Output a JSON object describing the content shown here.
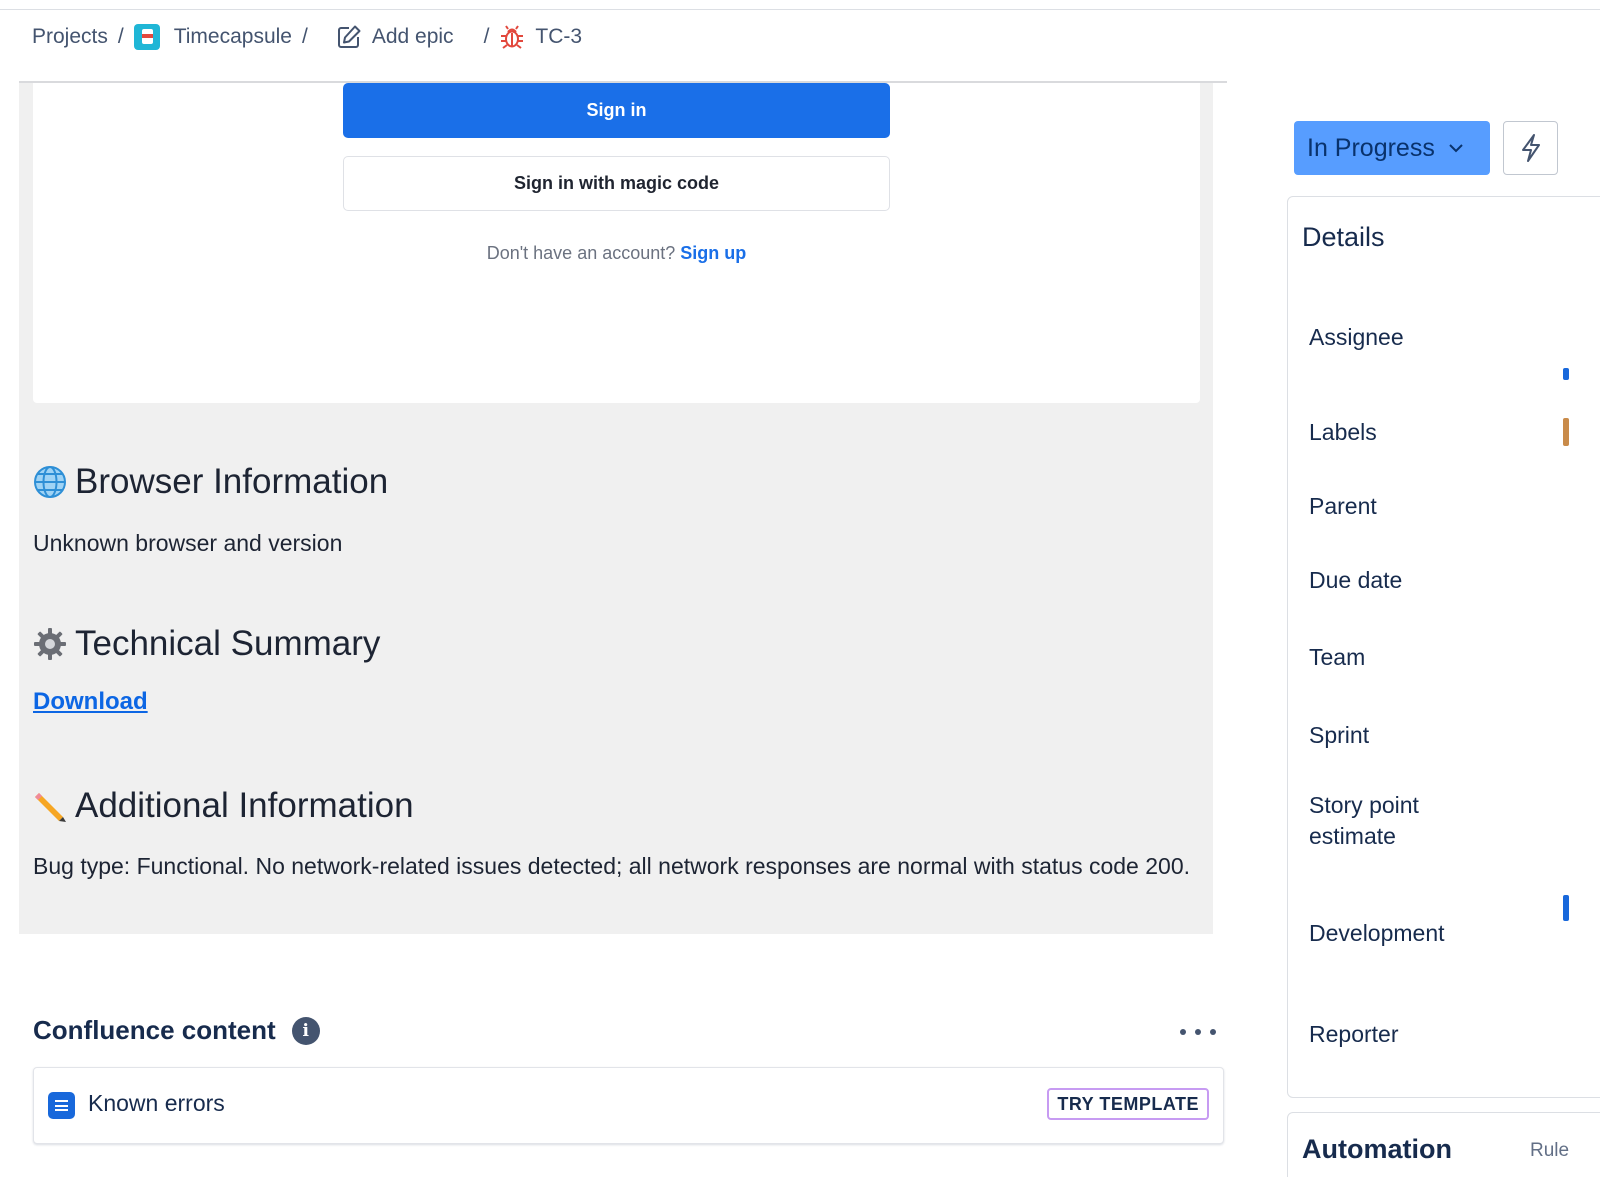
{
  "breadcrumb": {
    "projects": "Projects",
    "project": "Timecapsule",
    "epic": "Add epic",
    "issue": "TC-3",
    "separator": "/"
  },
  "screenshot": {
    "signin_label": "Sign in",
    "magic_label": "Sign in with magic code",
    "no_account_text": "Don't have an account?",
    "signup_link": "Sign up"
  },
  "description": {
    "browser_heading": "Browser Information",
    "browser_text": "Unknown browser and version",
    "technical_heading": "Technical Summary",
    "download_link": "Download",
    "additional_heading": "Additional Information",
    "additional_text": "Bug type: Functional. No network-related issues detected; all network responses are normal with status code 200."
  },
  "confluence": {
    "title": "Confluence content",
    "item_label": "Known errors",
    "template_button": "TRY TEMPLATE"
  },
  "status": {
    "label": "In Progress"
  },
  "details": {
    "title": "Details",
    "fields": {
      "assignee": "Assignee",
      "labels": "Labels",
      "parent": "Parent",
      "due_date": "Due date",
      "team": "Team",
      "sprint": "Sprint",
      "story_points": "Story point estimate",
      "development": "Development",
      "reporter": "Reporter"
    }
  },
  "automation": {
    "title": "Automation",
    "rules_label": "Rule"
  },
  "colors": {
    "status_bg": "#579dff",
    "primary_button": "#1a6fe8",
    "link": "#0c66e4",
    "description_bg": "#f0f0f0"
  }
}
